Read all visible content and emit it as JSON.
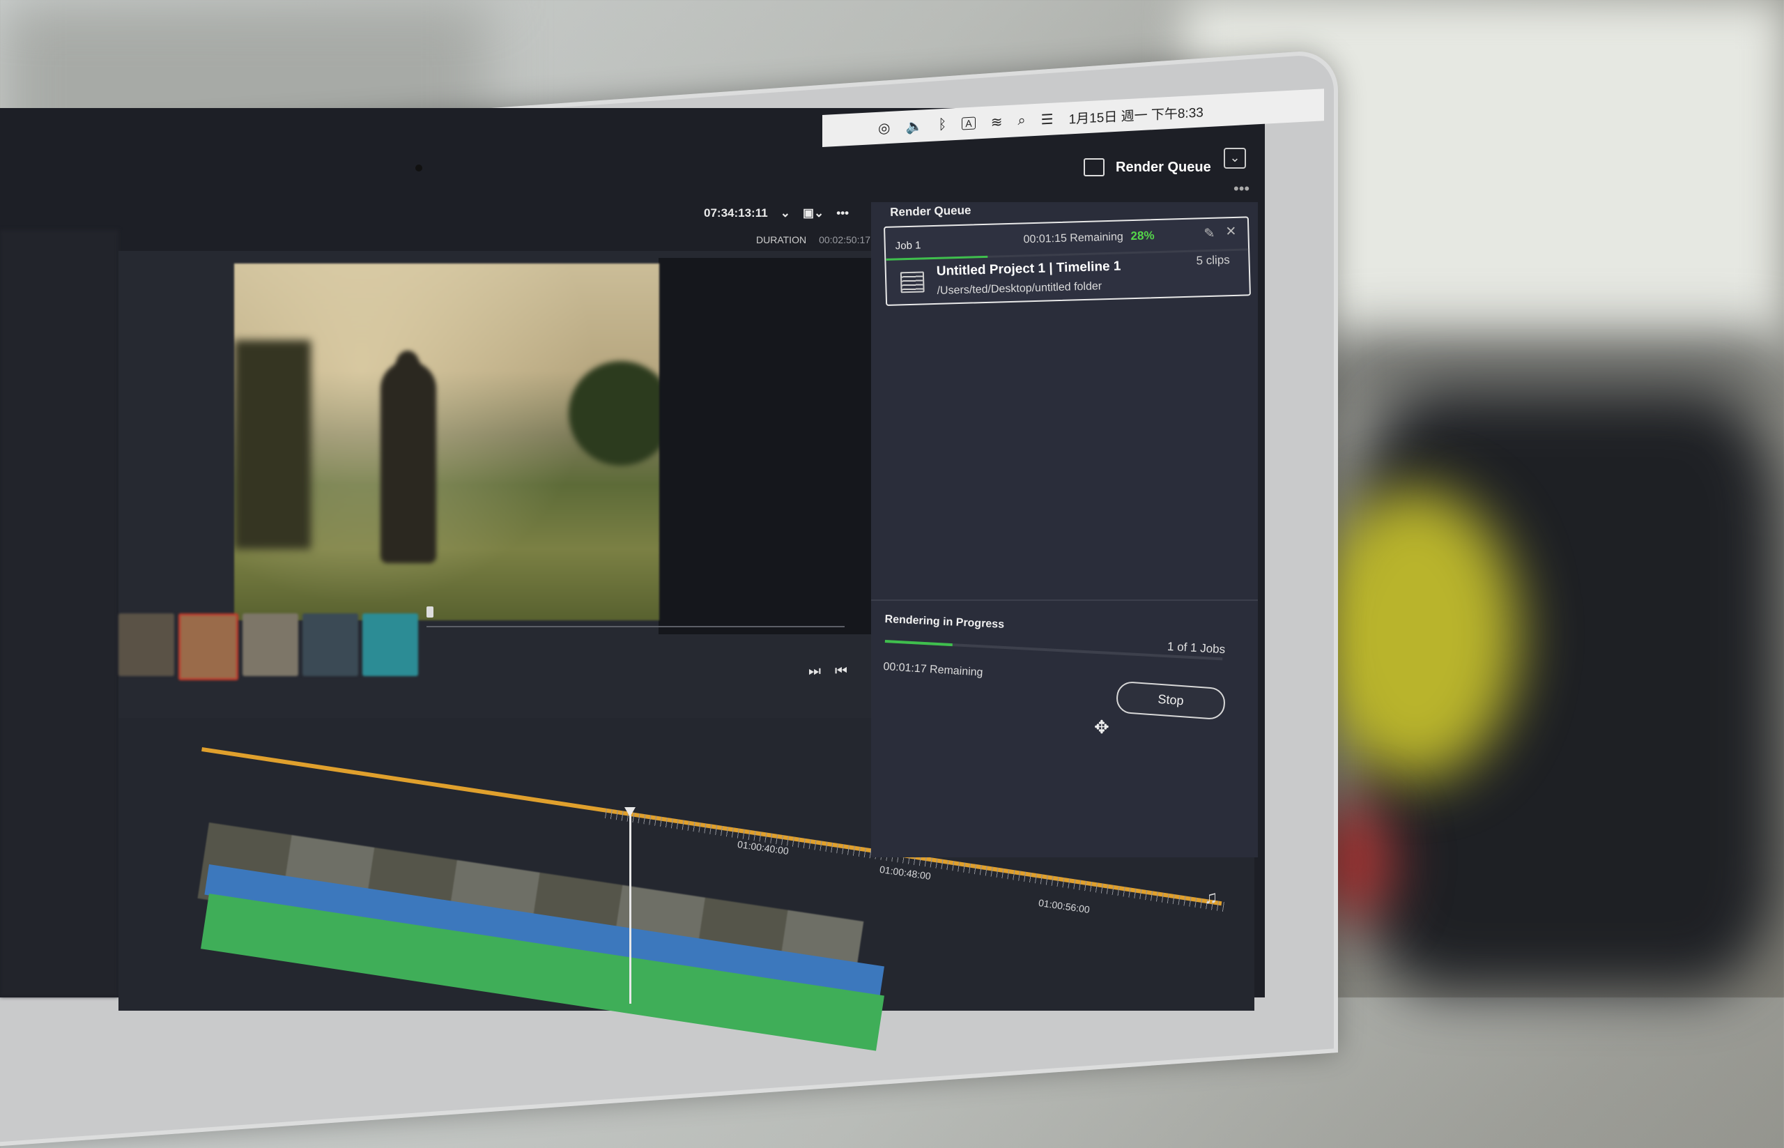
{
  "menubar": {
    "date_time": "1月15日 週一 下午8:33",
    "input_indicator": "A"
  },
  "render_queue_button": {
    "label": "Render Queue"
  },
  "viewer": {
    "timecode": "07:34:13:11",
    "duration_label": "DURATION",
    "duration_value": "00:02:50:17"
  },
  "render_queue": {
    "title": "Render Queue",
    "job": {
      "name": "Job 1",
      "remaining": "00:01:15 Remaining",
      "percent": "28%",
      "progress": 0.28,
      "title": "Untitled Project 1 | Timeline 1",
      "path": "/Users/ted/Desktop/untitled folder",
      "clips": "5 clips"
    },
    "status": {
      "label": "Rendering in Progress",
      "jobs_count": "1 of 1 Jobs",
      "remaining": "00:01:17 Remaining",
      "progress": 0.2,
      "stop_label": "Stop"
    }
  },
  "timeline": {
    "timecodes": [
      "01:00:40:00",
      "01:00:48:00",
      "01:00:56:00"
    ]
  },
  "colors": {
    "accent_green": "#55d64a",
    "timeline_orange": "#e0a02d",
    "track_blue": "#3c78bd",
    "track_green": "#3fae58"
  }
}
